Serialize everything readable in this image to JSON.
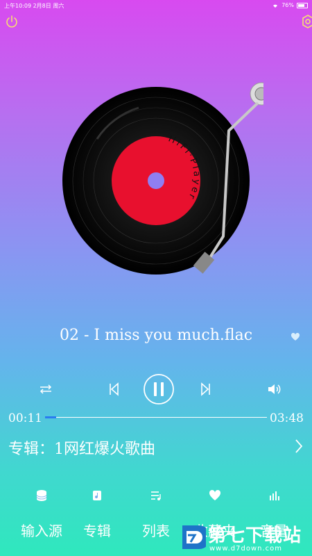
{
  "status_bar": {
    "time_date": "上午10:09  2月8日 周六",
    "battery_percent": "76%",
    "battery_level": 0.76
  },
  "record": {
    "label_text": "HiFi·Player"
  },
  "song": {
    "title": "02 - I miss you much.flac"
  },
  "playback": {
    "elapsed": "00:11",
    "duration": "03:48",
    "progress": 0.05
  },
  "album": {
    "label": "专辑：1网红爆火歌曲"
  },
  "tabs": [
    {
      "label": "输入源",
      "icon": "database-icon"
    },
    {
      "label": "专辑",
      "icon": "music-note-icon"
    },
    {
      "label": "列表",
      "icon": "playlist-icon"
    },
    {
      "label": "收藏夹",
      "icon": "heart-icon"
    },
    {
      "label": "音量",
      "icon": "volume-bars-icon"
    }
  ],
  "watermark": {
    "name": "第七下载站",
    "url": "www.d7down.com"
  },
  "colors": {
    "record_label": "#e8102e",
    "progress": "#2a7cf0"
  }
}
